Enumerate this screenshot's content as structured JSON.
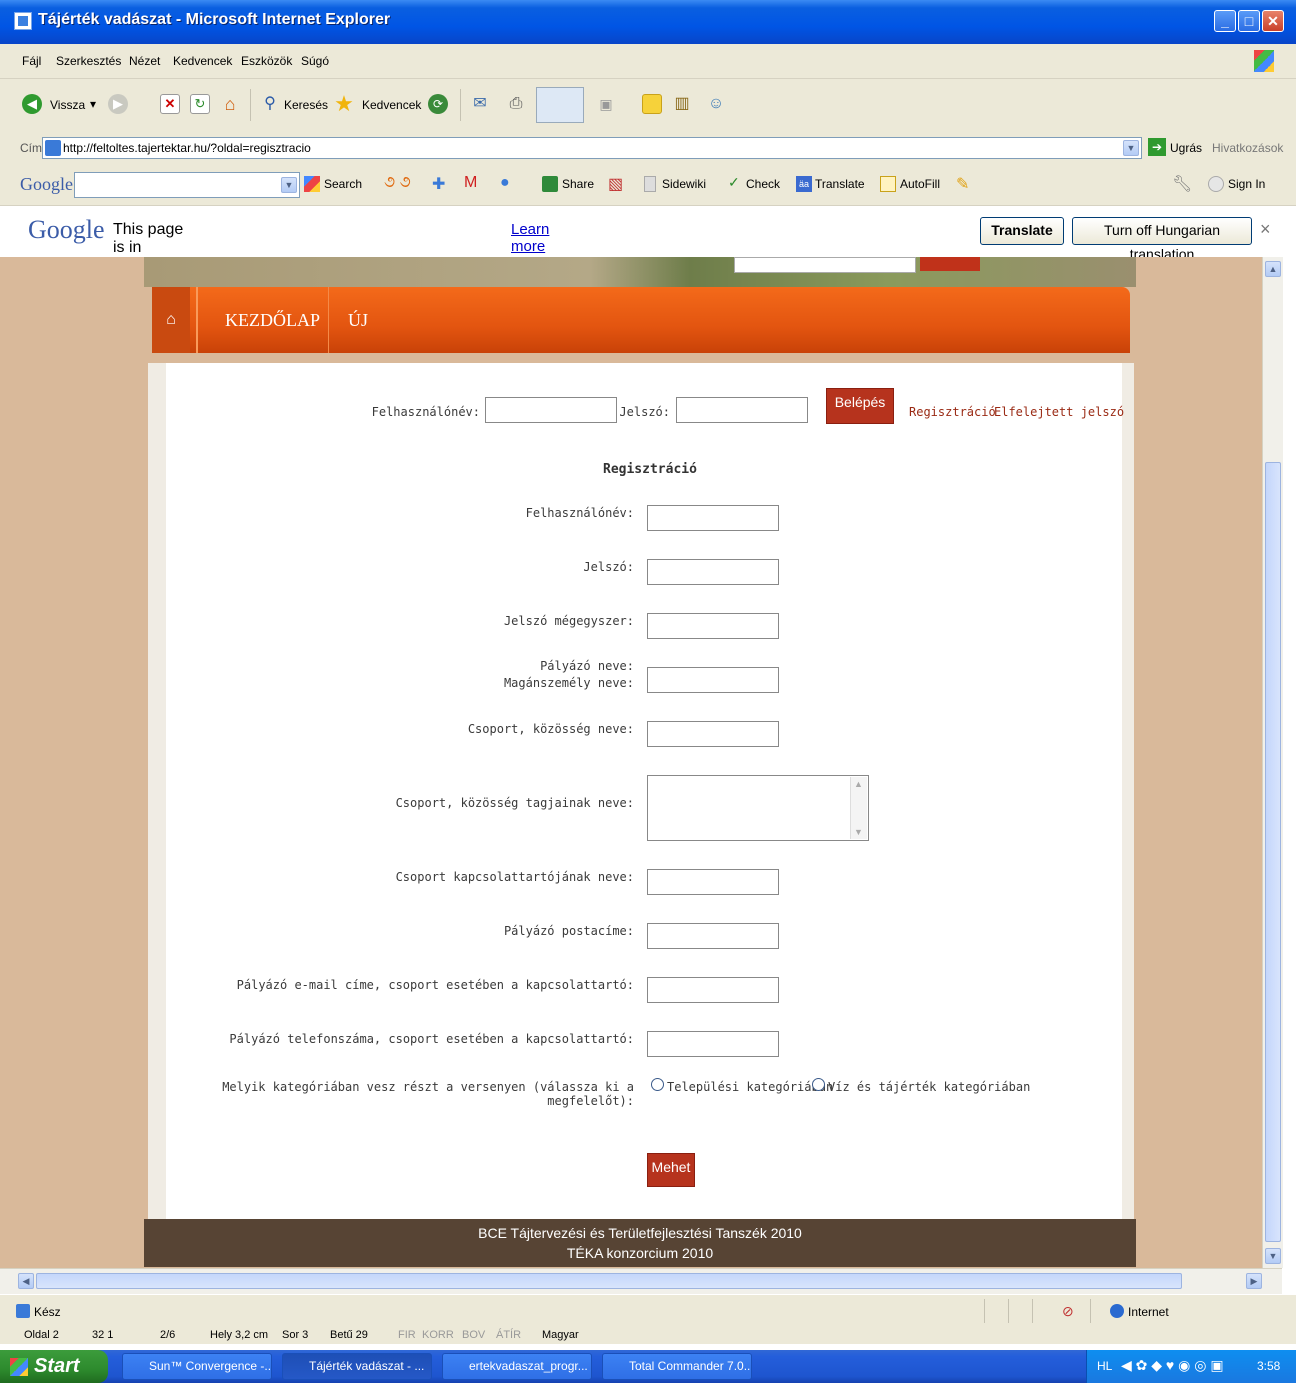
{
  "window": {
    "title": "Tájérték vadászat - Microsoft Internet Explorer"
  },
  "menu": [
    "Fájl",
    "Szerkesztés",
    "Nézet",
    "Kedvencek",
    "Eszközök",
    "Súgó"
  ],
  "toolbar": {
    "back_label": "Vissza",
    "search_label": "Keresés",
    "favorites_label": "Kedvencek"
  },
  "address": {
    "label": "Cím",
    "url": "http://feltoltes.tajertektar.hu/?oldal=regisztracio",
    "go_label": "Ugrás",
    "links_label": "Hivatkozások"
  },
  "googlebar": {
    "logo": "Google",
    "search_label": "Search",
    "share_label": "Share",
    "sidewiki_label": "Sidewiki",
    "check_label": "Check",
    "translate_label": "Translate",
    "autofill_label": "AutoFill",
    "signin_label": "Sign In"
  },
  "translatebar": {
    "logo": "Google",
    "message": "This page is in Hungarian.  Translate it using Google Toolbar?",
    "learn_more": "Learn more",
    "translate_button": "Translate",
    "turnoff_button": "Turn off Hungarian translation",
    "close": "×"
  },
  "nav": {
    "home_icon": "house-icon",
    "items": [
      "KEZDŐLAP",
      "ÚJ"
    ]
  },
  "login": {
    "username_label": "Felhasználónév:",
    "password_label": "Jelszó:",
    "login_button": "Belépés",
    "register_link": "Regisztráció",
    "forgot_link": "Elfelejtett jelszó"
  },
  "registration": {
    "heading": "Regisztráció",
    "fields": [
      {
        "label": "Felhasználónév:"
      },
      {
        "label": "Jelszó:"
      },
      {
        "label": "Jelszó mégegyszer:"
      },
      {
        "label": "Pályázó neve:\nMagánszemély neve:"
      },
      {
        "label": "Csoport, közösség neve:"
      },
      {
        "label": "Csoport, közösség tagjainak neve:"
      },
      {
        "label": "Csoport kapcsolattartójának neve:"
      },
      {
        "label": "Pályázó postacíme:"
      },
      {
        "label": "Pályázó e-mail címe, csoport esetében a kapcsolattartó:"
      },
      {
        "label": "Pályázó telefonszáma, csoport esetében a kapcsolattartó:"
      }
    ],
    "category_label": "Melyik kategóriában vesz részt a versenyen (válassza ki a megfelelőt):",
    "category_options": [
      "Települési kategóriában",
      "Víz és tájérték kategóriában"
    ],
    "submit_button": "Mehet"
  },
  "footer": {
    "line1": "BCE Tájtervezési és Területfejlesztési Tanszék 2010",
    "line2": "TÉKA konzorcium 2010"
  },
  "status": {
    "text": "Kész",
    "zone": "Internet"
  },
  "wordbar": [
    "Oldal 2",
    "32 1",
    "2/6",
    "Hely 3,2 cm",
    "Sor 3",
    "Betű 29",
    "FIR",
    "KORR",
    "BOV",
    "ÁTÍR",
    "Magyar"
  ],
  "taskbar": {
    "start": "Start",
    "tasks": [
      "Sun™ Convergence -...",
      "Tájérték vadászat - ...",
      "ertekvadaszat_progr...",
      "Total Commander 7.0..."
    ],
    "tray_lang": "HL",
    "clock": "3:58"
  }
}
